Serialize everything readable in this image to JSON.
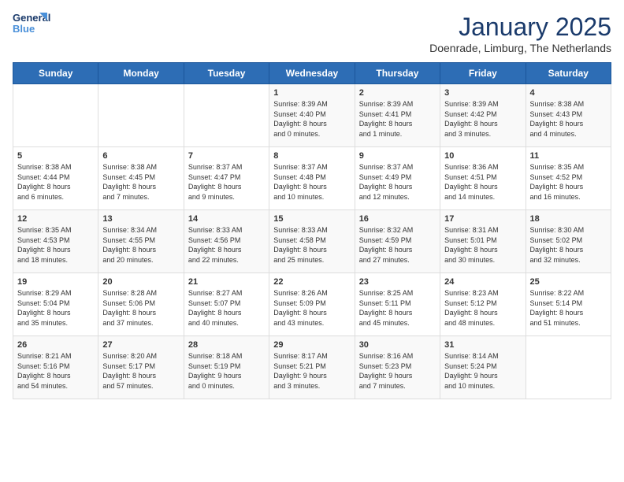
{
  "logo": {
    "line1": "General",
    "line2": "Blue"
  },
  "title": "January 2025",
  "location": "Doenrade, Limburg, The Netherlands",
  "weekdays": [
    "Sunday",
    "Monday",
    "Tuesday",
    "Wednesday",
    "Thursday",
    "Friday",
    "Saturday"
  ],
  "weeks": [
    [
      {
        "day": "",
        "content": ""
      },
      {
        "day": "",
        "content": ""
      },
      {
        "day": "",
        "content": ""
      },
      {
        "day": "1",
        "content": "Sunrise: 8:39 AM\nSunset: 4:40 PM\nDaylight: 8 hours\nand 0 minutes."
      },
      {
        "day": "2",
        "content": "Sunrise: 8:39 AM\nSunset: 4:41 PM\nDaylight: 8 hours\nand 1 minute."
      },
      {
        "day": "3",
        "content": "Sunrise: 8:39 AM\nSunset: 4:42 PM\nDaylight: 8 hours\nand 3 minutes."
      },
      {
        "day": "4",
        "content": "Sunrise: 8:38 AM\nSunset: 4:43 PM\nDaylight: 8 hours\nand 4 minutes."
      }
    ],
    [
      {
        "day": "5",
        "content": "Sunrise: 8:38 AM\nSunset: 4:44 PM\nDaylight: 8 hours\nand 6 minutes."
      },
      {
        "day": "6",
        "content": "Sunrise: 8:38 AM\nSunset: 4:45 PM\nDaylight: 8 hours\nand 7 minutes."
      },
      {
        "day": "7",
        "content": "Sunrise: 8:37 AM\nSunset: 4:47 PM\nDaylight: 8 hours\nand 9 minutes."
      },
      {
        "day": "8",
        "content": "Sunrise: 8:37 AM\nSunset: 4:48 PM\nDaylight: 8 hours\nand 10 minutes."
      },
      {
        "day": "9",
        "content": "Sunrise: 8:37 AM\nSunset: 4:49 PM\nDaylight: 8 hours\nand 12 minutes."
      },
      {
        "day": "10",
        "content": "Sunrise: 8:36 AM\nSunset: 4:51 PM\nDaylight: 8 hours\nand 14 minutes."
      },
      {
        "day": "11",
        "content": "Sunrise: 8:35 AM\nSunset: 4:52 PM\nDaylight: 8 hours\nand 16 minutes."
      }
    ],
    [
      {
        "day": "12",
        "content": "Sunrise: 8:35 AM\nSunset: 4:53 PM\nDaylight: 8 hours\nand 18 minutes."
      },
      {
        "day": "13",
        "content": "Sunrise: 8:34 AM\nSunset: 4:55 PM\nDaylight: 8 hours\nand 20 minutes."
      },
      {
        "day": "14",
        "content": "Sunrise: 8:33 AM\nSunset: 4:56 PM\nDaylight: 8 hours\nand 22 minutes."
      },
      {
        "day": "15",
        "content": "Sunrise: 8:33 AM\nSunset: 4:58 PM\nDaylight: 8 hours\nand 25 minutes."
      },
      {
        "day": "16",
        "content": "Sunrise: 8:32 AM\nSunset: 4:59 PM\nDaylight: 8 hours\nand 27 minutes."
      },
      {
        "day": "17",
        "content": "Sunrise: 8:31 AM\nSunset: 5:01 PM\nDaylight: 8 hours\nand 30 minutes."
      },
      {
        "day": "18",
        "content": "Sunrise: 8:30 AM\nSunset: 5:02 PM\nDaylight: 8 hours\nand 32 minutes."
      }
    ],
    [
      {
        "day": "19",
        "content": "Sunrise: 8:29 AM\nSunset: 5:04 PM\nDaylight: 8 hours\nand 35 minutes."
      },
      {
        "day": "20",
        "content": "Sunrise: 8:28 AM\nSunset: 5:06 PM\nDaylight: 8 hours\nand 37 minutes."
      },
      {
        "day": "21",
        "content": "Sunrise: 8:27 AM\nSunset: 5:07 PM\nDaylight: 8 hours\nand 40 minutes."
      },
      {
        "day": "22",
        "content": "Sunrise: 8:26 AM\nSunset: 5:09 PM\nDaylight: 8 hours\nand 43 minutes."
      },
      {
        "day": "23",
        "content": "Sunrise: 8:25 AM\nSunset: 5:11 PM\nDaylight: 8 hours\nand 45 minutes."
      },
      {
        "day": "24",
        "content": "Sunrise: 8:23 AM\nSunset: 5:12 PM\nDaylight: 8 hours\nand 48 minutes."
      },
      {
        "day": "25",
        "content": "Sunrise: 8:22 AM\nSunset: 5:14 PM\nDaylight: 8 hours\nand 51 minutes."
      }
    ],
    [
      {
        "day": "26",
        "content": "Sunrise: 8:21 AM\nSunset: 5:16 PM\nDaylight: 8 hours\nand 54 minutes."
      },
      {
        "day": "27",
        "content": "Sunrise: 8:20 AM\nSunset: 5:17 PM\nDaylight: 8 hours\nand 57 minutes."
      },
      {
        "day": "28",
        "content": "Sunrise: 8:18 AM\nSunset: 5:19 PM\nDaylight: 9 hours\nand 0 minutes."
      },
      {
        "day": "29",
        "content": "Sunrise: 8:17 AM\nSunset: 5:21 PM\nDaylight: 9 hours\nand 3 minutes."
      },
      {
        "day": "30",
        "content": "Sunrise: 8:16 AM\nSunset: 5:23 PM\nDaylight: 9 hours\nand 7 minutes."
      },
      {
        "day": "31",
        "content": "Sunrise: 8:14 AM\nSunset: 5:24 PM\nDaylight: 9 hours\nand 10 minutes."
      },
      {
        "day": "",
        "content": ""
      }
    ]
  ]
}
